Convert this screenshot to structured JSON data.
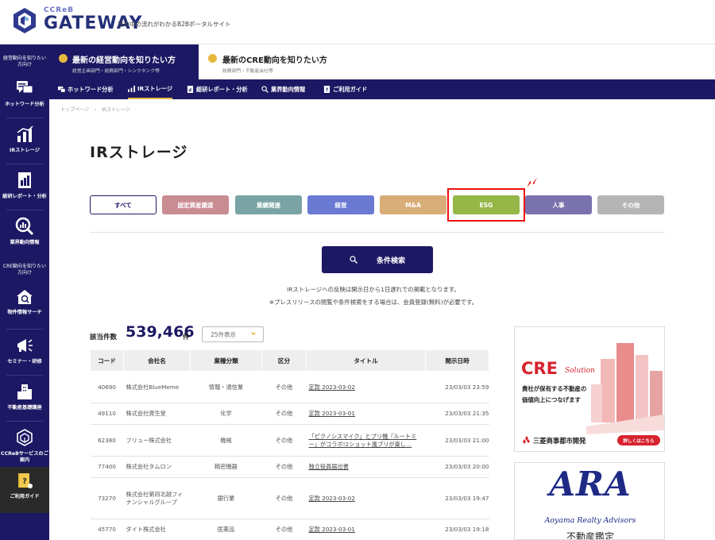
{
  "header": {
    "logo_small": "CCReB",
    "logo_big": "GATEWAY",
    "tagline": "世の中の流れがわかるB2Bポータルサイト"
  },
  "sidebar": {
    "caption_top": "経営動向を知りたい方向け",
    "caption_mid": "CRE動向を知りたい方向け",
    "items": [
      {
        "label": "ホットワード分析",
        "icon": "hotword-icon"
      },
      {
        "label": "IRストレージ",
        "icon": "bar-chart-icon"
      },
      {
        "label": "総研レポート・分析",
        "icon": "report-icon"
      },
      {
        "label": "業界動向情報",
        "icon": "magnify-chart-icon"
      },
      {
        "label": "物件情報サーチ",
        "icon": "building-search-icon"
      },
      {
        "label": "セミナー・研修",
        "icon": "megaphone-icon"
      },
      {
        "label": "不動産基礎講座",
        "icon": "tower-icon"
      },
      {
        "label": "CCReBサービスのご案内",
        "icon": "cube-icon"
      },
      {
        "label": "ご利用ガイド",
        "icon": "guide-book-icon"
      }
    ]
  },
  "tabs": [
    {
      "title": "最新の経営動向を知りたい方",
      "sub": "経営企画部門・総務部門・シンクタンク等"
    },
    {
      "title": "最新のCRE動向を知りたい方",
      "sub": "総務部門・不動産会社等"
    }
  ],
  "subnav": [
    {
      "label": "ホットワード分析"
    },
    {
      "label": "IRストレージ"
    },
    {
      "label": "総研レポート・分析"
    },
    {
      "label": "業界動向情報"
    },
    {
      "label": "ご利用ガイド"
    }
  ],
  "breadcrumb": [
    "トップページ",
    "›",
    "IRストレージ"
  ],
  "page_title": "IRストレージ",
  "categories": [
    {
      "label": "すべて",
      "color": "#ffffff"
    },
    {
      "label": "固定資産譲渡",
      "color": "#c98c93"
    },
    {
      "label": "業績関連",
      "color": "#7aa3a5"
    },
    {
      "label": "経営",
      "color": "#6a7ad3"
    },
    {
      "label": "M&A",
      "color": "#d9ad78"
    },
    {
      "label": "ESG",
      "color": "#95b748"
    },
    {
      "label": "人事",
      "color": "#7a72ae"
    },
    {
      "label": "その他",
      "color": "#b5b5b5"
    }
  ],
  "search_button": "条件検索",
  "notes": [
    "IRストレージへの反映は開示日から1日遅れでの掲載となります。",
    "※プレスリリースの閲覧や条件検索をする場合は、会員登録(無料)が必要です。"
  ],
  "results": {
    "count_label": "該当件数",
    "count": "539,466",
    "count_unit": "件",
    "per_page": "25件表示",
    "columns": [
      "コード",
      "会社名",
      "業種分類",
      "区分",
      "タイトル",
      "開示日時"
    ],
    "rows": [
      [
        "40690",
        "株式会社BlueMeme",
        "情報・通信業",
        "その他",
        "定款 2023-03-02",
        "23/03/03 23:59"
      ],
      [
        "49110",
        "株式会社資生堂",
        "化学",
        "その他",
        "定款 2023-03-01",
        "23/03/03 21:35"
      ],
      [
        "62380",
        "フリュー株式会社",
        "機械",
        "その他",
        "「ピクノシスマイク」とプリ機『ルートミー』がコラボ!2ショット風プリが楽し…",
        "23/03/03 21:00"
      ],
      [
        "77400",
        "株式会社タムロン",
        "精密機器",
        "その他",
        "独立役員届出書",
        "23/03/03 20:00"
      ],
      [
        "73270",
        "株式会社第四北越フィナンシャルグループ",
        "銀行業",
        "その他",
        "定款 2023-03-02",
        "23/03/03 19:47"
      ],
      [
        "45770",
        "ダイト株式会社",
        "医薬品",
        "その他",
        "定款 2023-03-01",
        "23/03/03 19:18"
      ]
    ]
  },
  "ads": {
    "ad1": {
      "title": "CRE",
      "title_sub": "Solution",
      "text1": "貴社が保有する不動産の",
      "text2": "価値向上につなげます",
      "brand": "三菱商事都市開発",
      "cta": "詳しくはこちら"
    },
    "ad2": {
      "logo": "ARA",
      "name": "Aoyama Realty Advisors",
      "jp": "不動産鑑定"
    }
  }
}
